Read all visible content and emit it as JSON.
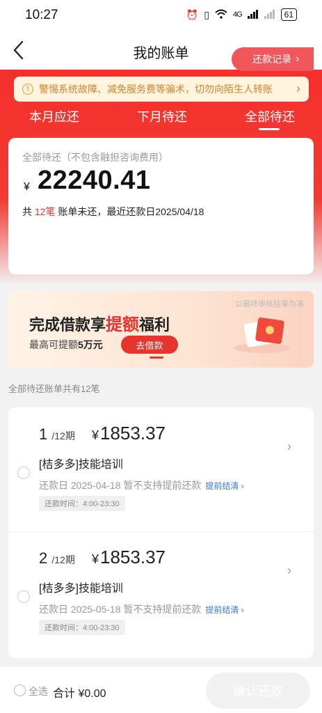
{
  "status_bar": {
    "time": "10:27",
    "network": "4G",
    "battery": "61"
  },
  "nav": {
    "title": "我的账单"
  },
  "notice": {
    "icon": "warning-icon",
    "text": "警惕系统故障、减免服务费等骗术，切勿向陌生人转账"
  },
  "tabs": [
    {
      "label": "本月应还"
    },
    {
      "label": "下月待还"
    },
    {
      "label": "全部待还",
      "active": true
    }
  ],
  "summary": {
    "label": "全部待还（不包含融担咨询费用）",
    "currency": "¥",
    "amount": "22240.41",
    "info_prefix": "共 ",
    "count": "12笔",
    "info_suffix": " 账单未还，最近还款日2025/04/18",
    "repay_record_label": "还款记录"
  },
  "banner": {
    "note": "以最终审核结果为准",
    "title_pre": "完成借款享",
    "title_hl": "提额",
    "title_post": "福利",
    "sub_pre": "最高可提额",
    "sub_bold": "5万元",
    "button": "去借款"
  },
  "list_caption": "全部待还账单共有12笔",
  "bills": [
    {
      "period": "1",
      "total_periods": "/12期",
      "yen": "¥",
      "amount": "1853.37",
      "name": "[桔多多]技能培训",
      "date": "还款日 2025-04-18 暂不支持提前还款",
      "link": "提前结清 ›",
      "tag": "还款时间：4:00-23:30"
    },
    {
      "period": "2",
      "total_periods": "/12期",
      "yen": "¥",
      "amount": "1853.37",
      "name": "[桔多多]技能培训",
      "date": "还款日 2025-05-18 暂不支持提前还款",
      "link": "提前结清 ›",
      "tag": "还款时间：4:00-23:30"
    }
  ],
  "bottom": {
    "select_all": "全选",
    "total": "合计 ¥0.00",
    "confirm": "确认还款"
  },
  "colors": {
    "brand_red": "#f5302c",
    "link_blue": "#3a78d8",
    "notice_orange": "#d9822b"
  }
}
